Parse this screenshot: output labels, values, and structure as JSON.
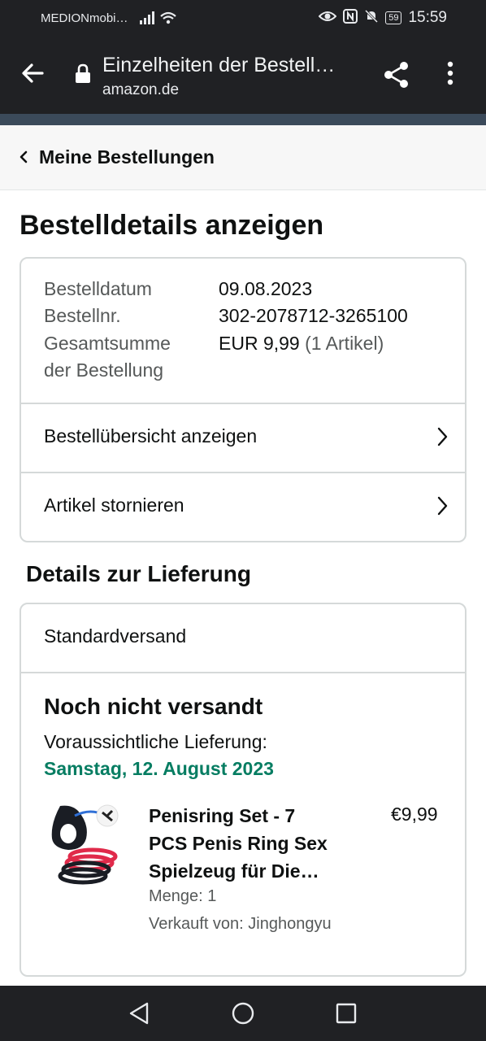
{
  "status_bar": {
    "carrier": "MEDIONmobi…",
    "battery": "59",
    "time": "15:59"
  },
  "browser": {
    "page_title": "Einzelheiten der Bestell…",
    "domain": "amazon.de",
    "icons": [
      "back-arrow-icon",
      "lock-icon",
      "share-icon",
      "more-vert-icon"
    ]
  },
  "breadcrumb": {
    "label": "Meine Bestellungen"
  },
  "page": {
    "title": "Bestelldetails anzeigen"
  },
  "order_summary": {
    "date_label": "Bestelldatum",
    "date_value": "09.08.2023",
    "number_label": "Bestellnr.",
    "number_value": "302-2078712-3265100",
    "total_label_line1": "Gesamtsumme",
    "total_label_line2": "der Bestellung",
    "total_value": "EUR 9,99",
    "total_items": "(1 Artikel)"
  },
  "actions": {
    "view_summary": "Bestellübersicht anzeigen",
    "cancel_items": "Artikel stornieren"
  },
  "delivery": {
    "section_title": "Details zur Lieferung",
    "method": "Standardversand",
    "status": "Noch nicht versandt",
    "estimate_label": "Voraussichtliche Lieferung:",
    "estimate_date": "Samstag, 12. August 2023",
    "date_color": "#067d62"
  },
  "item": {
    "title_line1": "Penisring Set - 7",
    "title_line2": "PCS Penis Ring Sex",
    "title_line3": "Spielzeug für Die…",
    "price": "€9,99",
    "quantity": "Menge: 1",
    "seller": "Verkauft von: Jinghongyu"
  }
}
